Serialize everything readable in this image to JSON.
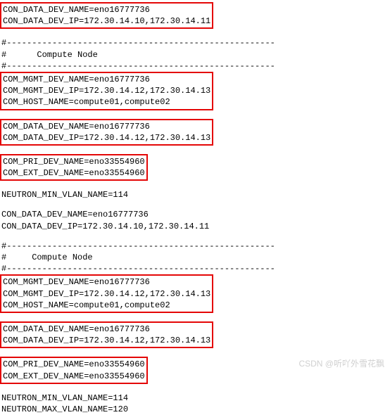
{
  "section1": {
    "box1": {
      "line1": "CON_DATA_DEV_NAME=eno16777736",
      "line2": "CON_DATA_DEV_IP=172.30.14.10,172.30.14.11"
    },
    "separator1": "#-----------------------------------------------------",
    "header": "#      Compute Node",
    "separator2": "#-----------------------------------------------------",
    "box2": {
      "line1": "COM_MGMT_DEV_NAME=eno16777736",
      "line2": "COM_MGMT_DEV_IP=172.30.14.12,172.30.14.13",
      "line3": "COM_HOST_NAME=compute01,compute02"
    },
    "box3": {
      "line1": "COM_DATA_DEV_NAME=eno16777736",
      "line2": "COM_DATA_DEV_IP=172.30.14.12,172.30.14.13"
    },
    "box4": {
      "line1": "COM_PRI_DEV_NAME=eno33554960",
      "line2": "COM_EXT_DEV_NAME=eno33554960"
    },
    "neutron": "NEUTRON_MIN_VLAN_NAME=114"
  },
  "section2": {
    "line1": "CON_DATA_DEV_NAME=eno16777736",
    "line2": "CON_DATA_DEV_IP=172.30.14.10,172.30.14.11",
    "separator1": "#-----------------------------------------------------",
    "header": "#     Compute Node",
    "separator2": "#-----------------------------------------------------",
    "box1": {
      "line1": "COM_MGMT_DEV_NAME=eno16777736",
      "line2": "COM_MGMT_DEV_IP=172.30.14.12,172.30.14.13",
      "line3": "COM_HOST_NAME=compute01,compute02"
    },
    "box2": {
      "line1": "COM_DATA_DEV_NAME=eno16777736",
      "line2": "COM_DATA_DEV_IP=172.30.14.12,172.30.14.13"
    },
    "box3": {
      "line1": "COM_PRI_DEV_NAME=eno33554960",
      "line2": "COM_EXT_DEV_NAME=eno33554960"
    },
    "neutron1": "NEUTRON_MIN_VLAN_NAME=114",
    "neutron2": "NEUTRON_MAX_VLAN_NAME=120"
  },
  "watermark": "CSDN @听吖外雪花飘"
}
